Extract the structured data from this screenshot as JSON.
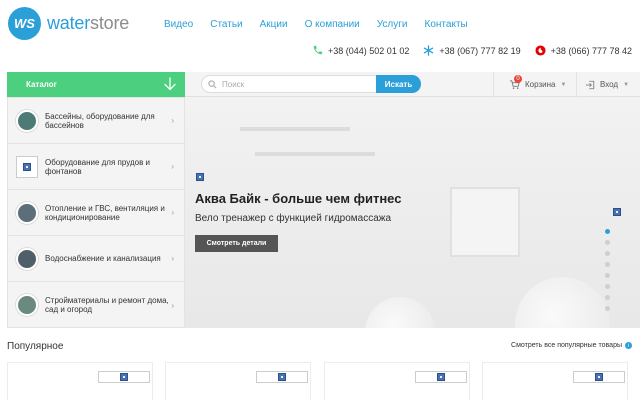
{
  "logo": {
    "mark": "WS",
    "brand_part1": "water",
    "brand_part2": "store"
  },
  "topnav": [
    "Видео",
    "Статьи",
    "Акции",
    "О компании",
    "Услуги",
    "Контакты"
  ],
  "phones": [
    "+38 (044) 502 01 02",
    "+38 (067) 777 82 19",
    "+38 (066) 777 78 42"
  ],
  "catalog": {
    "label": "Каталог"
  },
  "search": {
    "placeholder": "Поиск",
    "button": "Искать"
  },
  "cart": {
    "label": "Корзина",
    "count": "0"
  },
  "login": {
    "label": "Вход"
  },
  "categories": [
    "Бассейны, оборудование для бассейнов",
    "Оборудование для прудов и фонтанов",
    "Отопление и ГВС, вентиляция и кондиционирование",
    "Водоснабжение и канализация",
    "Стройматериалы и ремонт дома, сад и огород"
  ],
  "hero": {
    "title": "Аква Байк - больше чем фитнес",
    "subtitle": "Вело тренажер с функцией гидромассажа",
    "button": "Смотреть детали",
    "slides": 8,
    "active_slide": 1
  },
  "popular": {
    "title": "Популярное",
    "link": "Смотреть все популярные товары"
  },
  "colors": {
    "accent": "#2a9fd8",
    "green": "#4ccf7f",
    "dark_button": "#555555"
  }
}
